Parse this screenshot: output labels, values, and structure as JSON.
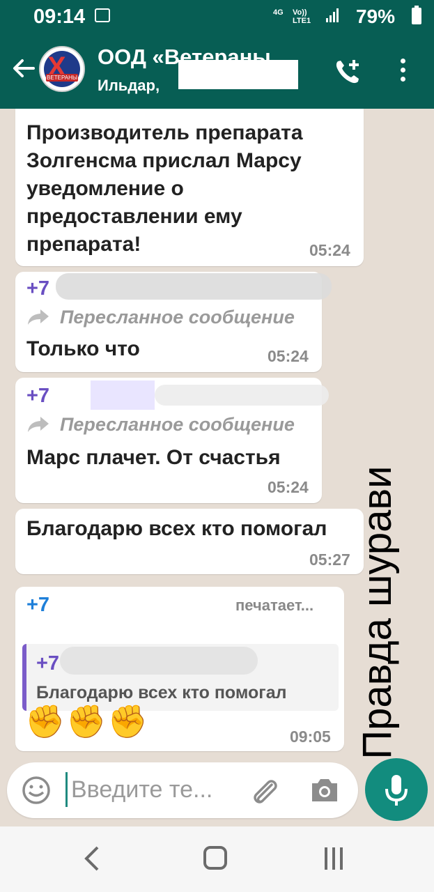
{
  "status_bar": {
    "time": "09:14",
    "network_top": "4G",
    "network_volte": "Vo))",
    "network_lte": "LTE1",
    "battery": "79%"
  },
  "header": {
    "title": "ООД «Ветераны...",
    "subtitle": "Ильдар,",
    "avatar_label": "ВЕТЕРАНЫ"
  },
  "messages": [
    {
      "text_lines": [
        "Производитель препарата",
        "Золгенсма прислал Марсу",
        "уведомление о",
        "предоставлении ему",
        "препарата!"
      ],
      "time": "05:24"
    },
    {
      "sender": "+7",
      "forwarded": "Пересланное сообщение",
      "text": "Только что",
      "time": "05:24"
    },
    {
      "sender": "+7",
      "forwarded": "Пересланное сообщение",
      "text": "Марс плачет. От счастья",
      "time": "05:24"
    },
    {
      "text": "Благодарю всех кто помогал",
      "time": "05:27"
    },
    {
      "sender": "+7",
      "typing": "печатает...",
      "quote_sender": "+7",
      "quote_text": "Благодарю всех кто помогал",
      "text": "✊✊✊",
      "time": "09:05"
    }
  ],
  "watermark": "Правда шурави",
  "input": {
    "placeholder": "Введите те..."
  },
  "colors": {
    "header": "#075e54",
    "chat_background": "#e6ddd4",
    "accent": "#128c7e",
    "sender": "#6a4fc2"
  }
}
